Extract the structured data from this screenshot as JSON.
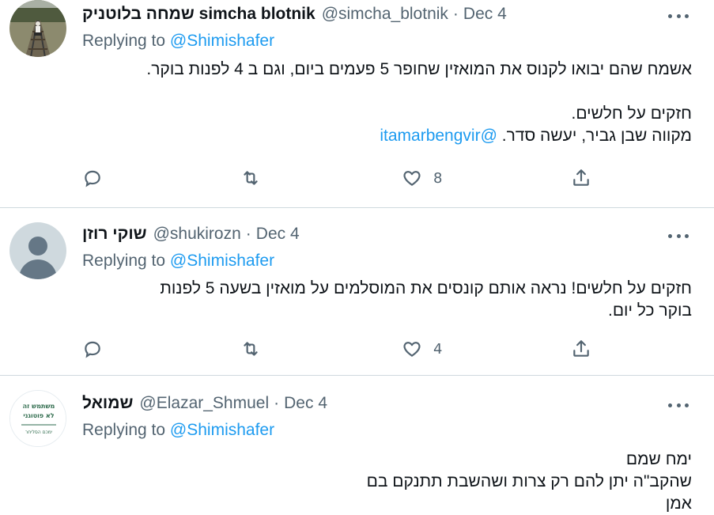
{
  "tweets": [
    {
      "name": "שמחה בלוטניק simcha blotnik",
      "handle": "@simcha_blotnik",
      "date": "Dec 4",
      "replying_prefix": "Replying to",
      "replying_to": "@Shimishafer",
      "lines": [
        "אשמח שהם יבואו לקנוס את המואזין שחופר 5 פעמים ביום, וגם ב 4 לפנות בוקר.",
        "",
        "חזקים על חלשים.",
        "מקווה שבן גביר, יעשה סדר."
      ],
      "inline_mention": "@itamarbengvir",
      "likes": "8",
      "avatar_icon": "photo-avatar-railway"
    },
    {
      "name": "שוקי רוזן",
      "handle": "@shukirozn",
      "date": "Dec 4",
      "replying_prefix": "Replying to",
      "replying_to": "@Shimishafer",
      "lines": [
        "חזקים על חלשים! נראה אותם קונסים את המוסלמים על מואזין בשעה 5 לפנות",
        "בוקר כל יום."
      ],
      "likes": "4",
      "avatar_icon": "default-user-avatar"
    },
    {
      "name": "שמואל",
      "handle": "@Elazar_Shmuel",
      "date": "Dec 4",
      "replying_prefix": "Replying to",
      "replying_to": "@Shimishafer",
      "lines": [
        "ימח שמם",
        "שהקב\"ה יתן להם רק צרות ושהשבת תתנקם בם",
        "אמן"
      ],
      "avatar_text": [
        "משתמש זה",
        "לא פוטוגני",
        "ימכם הסליחר"
      ],
      "avatar_icon": "text-logo-avatar"
    }
  ],
  "colors": {
    "link": "#1d9bf0",
    "secondary": "#536471",
    "divider": "#cfd9de"
  }
}
